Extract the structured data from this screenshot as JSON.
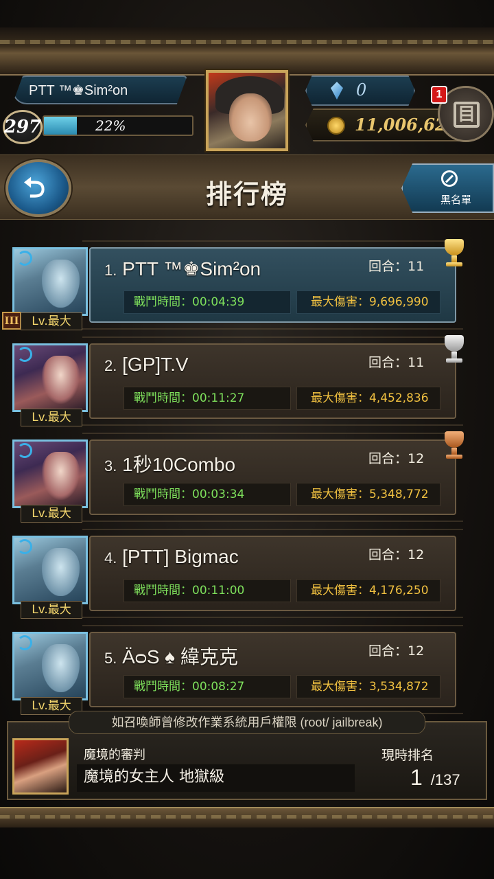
{
  "player": {
    "name": "PTT ™♚Sim²on",
    "level": "297",
    "exp_percent": "22%",
    "exp_fraction": 0.22,
    "gems": "0",
    "coins": "11,006,62",
    "mail_badge": "1"
  },
  "page": {
    "title": "排行榜",
    "blacklist_label": "黑名單"
  },
  "ranking": [
    {
      "rank": "1.",
      "name": "PTT ™♚Sim²on",
      "turns": "回合：11",
      "time": "戰鬥時間：00:04:39",
      "damage": "最大傷害：9,696,990",
      "lv": "Lv.最大",
      "rank_badge": "III",
      "trophy": "gold"
    },
    {
      "rank": "2.",
      "name": "[GP]T.V",
      "turns": "回合：11",
      "time": "戰鬥時間：00:11:27",
      "damage": "最大傷害：4,452,836",
      "lv": "Lv.最大",
      "trophy": "silver"
    },
    {
      "rank": "3.",
      "name": "1秒10Combo",
      "turns": "回合：12",
      "time": "戰鬥時間：00:03:34",
      "damage": "最大傷害：5,348,772",
      "lv": "Lv.最大",
      "trophy": "bronze"
    },
    {
      "rank": "4.",
      "name": "[PTT] Bigmac",
      "turns": "回合：12",
      "time": "戰鬥時間：00:11:00",
      "damage": "最大傷害：4,176,250",
      "lv": "Lv.最大"
    },
    {
      "rank": "5.",
      "name": "ÄᴑS ♠ 緯克克",
      "turns": "回合：12",
      "time": "戰鬥時間：00:08:27",
      "damage": "最大傷害：3,534,872",
      "lv": "Lv.最大"
    }
  ],
  "footer": {
    "warning": "如召喚師曾修改作業系統用戶權限 (root/ jailbreak)",
    "stage_label": "魔境的審判",
    "stage_name": "魔境的女主人 地獄級",
    "current_rank_label": "現時排名",
    "current_rank": "1",
    "total": "/137"
  },
  "colors": {
    "time_green": "#7ee05c",
    "damage_gold": "#f0c040",
    "accent_blue": "#2b6a8e"
  }
}
